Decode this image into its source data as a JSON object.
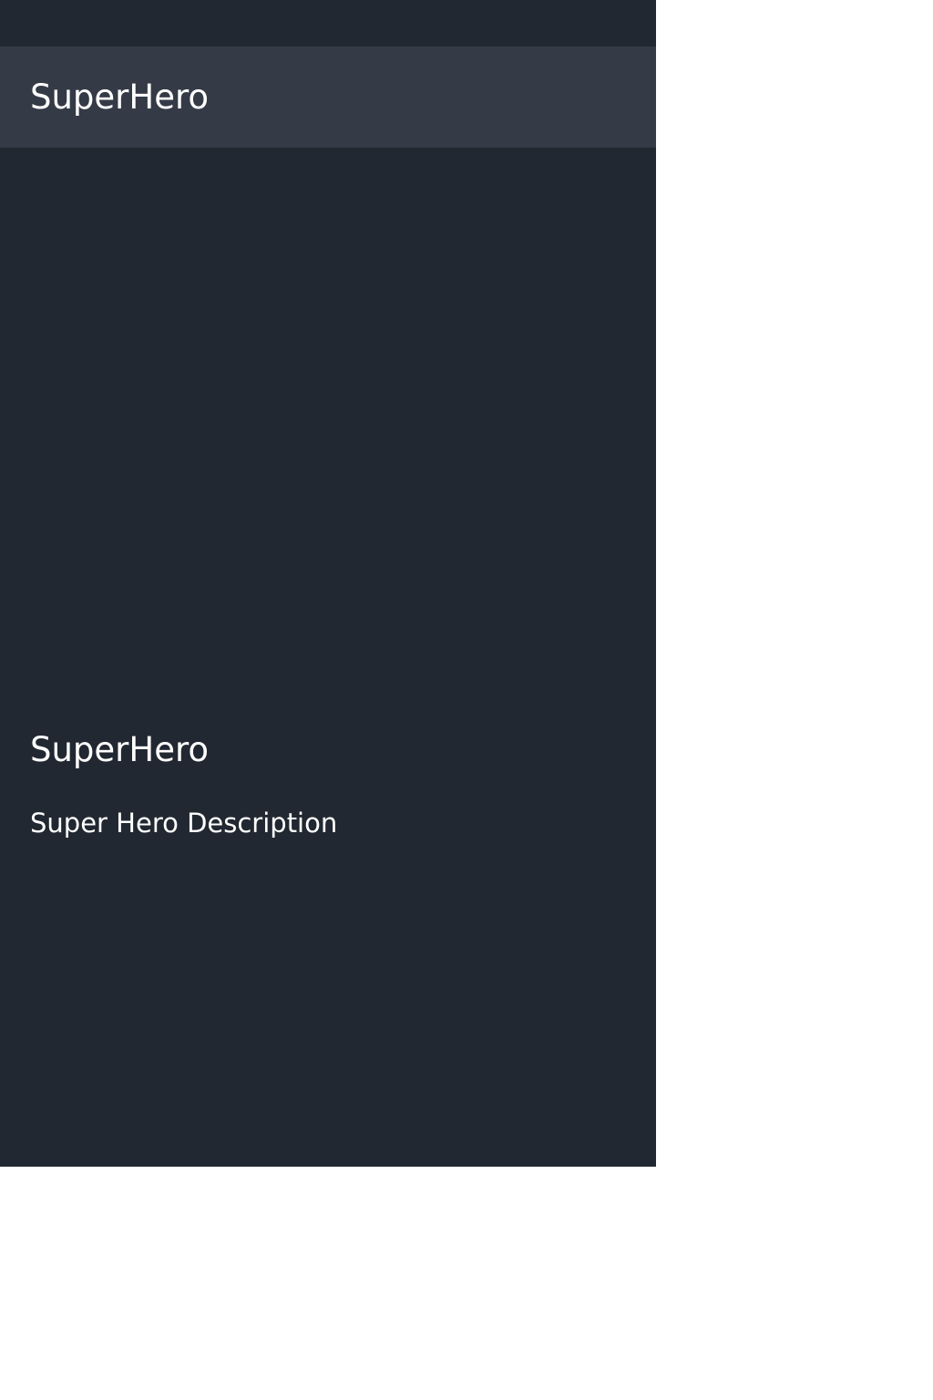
{
  "app_bar": {
    "title": "SuperHero"
  },
  "detail": {
    "name": "SuperHero",
    "description": "Super Hero Description"
  },
  "colors": {
    "background": "#222831",
    "app_bar": "#343a46",
    "text": "#ffffff",
    "outside": "#ffffff"
  }
}
